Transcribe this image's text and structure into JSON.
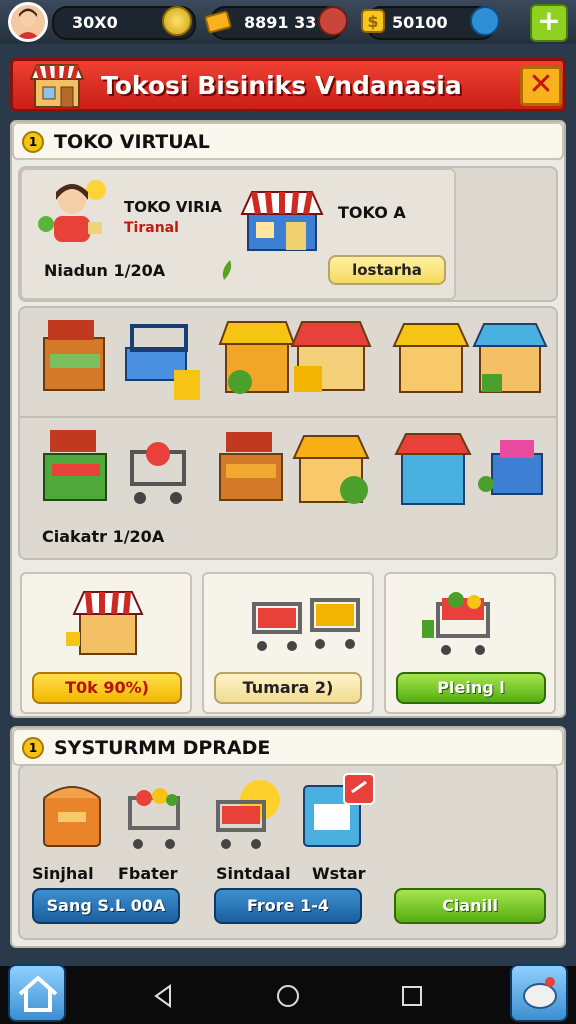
{
  "topbar": {
    "coins_1": "30X0",
    "coins_2": "8891 33",
    "coins_3": "50100",
    "plus_label": "+"
  },
  "banner": {
    "title": "Tokosi Bisiniks Vndanasia",
    "close_label": "✕"
  },
  "section1": {
    "header": "TOKO VIRTUAL",
    "profile": {
      "name": "TOKO VIRIA",
      "subtitle": "Tiranal",
      "date_text": "Niadun 1/20A"
    },
    "shop_a": {
      "name": "TOKO A",
      "tag": "lostarha"
    },
    "grid_caption": "Ciakatr 1/20A",
    "cards": [
      {
        "button": "T0k 90%)"
      },
      {
        "button": "Tumara 2)"
      },
      {
        "button": "Pleing l"
      }
    ]
  },
  "section2": {
    "header": "SYSTURMM DPRADE",
    "labels": [
      "Sinjhal",
      "Fbater",
      "Sintdaal",
      "Wstar"
    ],
    "buttons": [
      "Sang S.L 00A",
      "Frore 1-4",
      "Cianill"
    ]
  },
  "colors": {
    "banner_red": "#e0352a",
    "accent_yellow": "#f6c415",
    "accent_green": "#6bbd1b",
    "accent_blue": "#2a74b8"
  }
}
